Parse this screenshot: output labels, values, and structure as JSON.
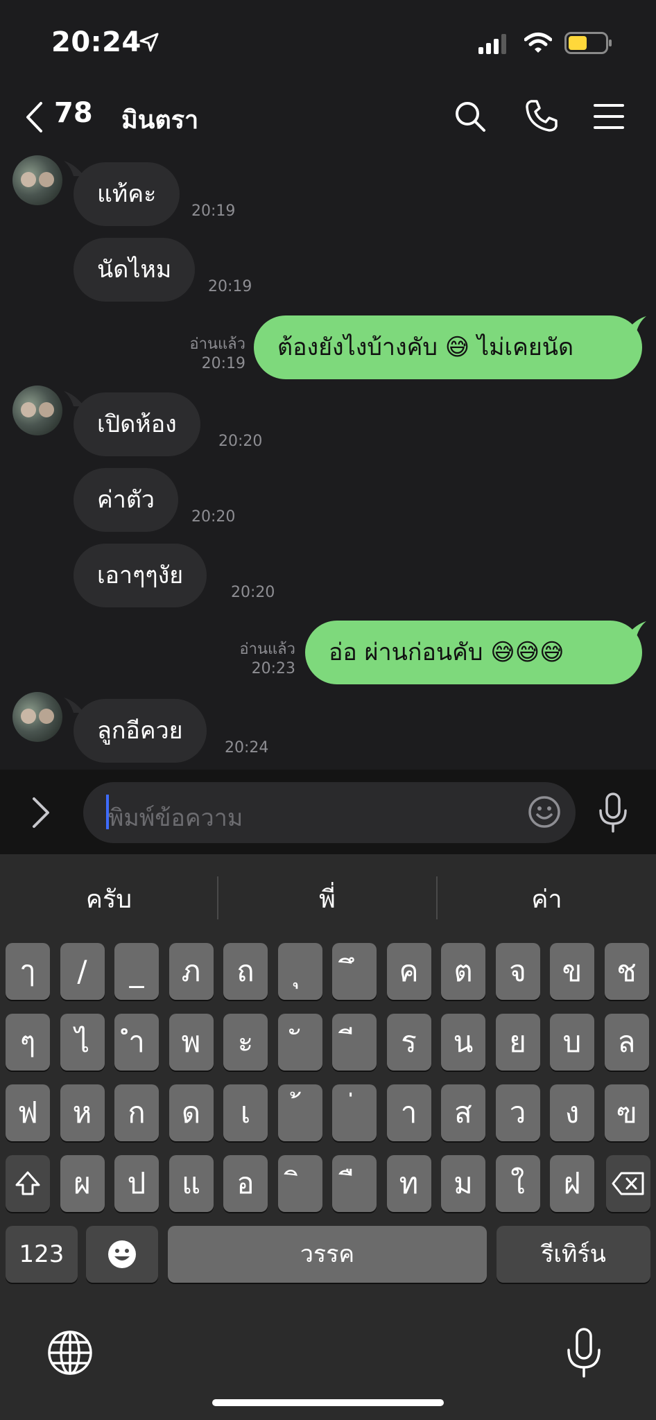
{
  "status": {
    "time": "20:24"
  },
  "header": {
    "back_count": "78",
    "contact_name": "มินตรา"
  },
  "messages": [
    {
      "side": "in",
      "text": "แท้คะ",
      "time": "20:19"
    },
    {
      "side": "in",
      "text": "นัดไหม",
      "time": "20:19"
    },
    {
      "side": "out",
      "text": "ต้องยังไงบ้างคับ 😅 ไม่เคยนัด",
      "time": "20:19",
      "read": "อ่านแล้ว"
    },
    {
      "side": "in",
      "text": "เปิดห้อง",
      "time": "20:20"
    },
    {
      "side": "in",
      "text": "ค่าตัว",
      "time": "20:20"
    },
    {
      "side": "in",
      "text": "เอาๆๆงัย",
      "time": "20:20"
    },
    {
      "side": "out",
      "text": "อ่อ ผ่านก่อนคับ 😅😅😅",
      "time": "20:23",
      "read": "อ่านแล้ว"
    },
    {
      "side": "in",
      "text": "ลูกอีควย",
      "time": "20:24"
    }
  ],
  "input": {
    "placeholder": "พิมพ์ข้อความ"
  },
  "keyboard": {
    "suggestions": [
      "ครับ",
      "พี่",
      "ค่า"
    ],
    "row1": [
      "ๅ",
      "/",
      "_",
      "ภ",
      "ถ",
      "ุ",
      "ึ",
      "ค",
      "ต",
      "จ",
      "ข",
      "ช"
    ],
    "row2": [
      "ๆ",
      "ไ",
      "ำ",
      "พ",
      "ะ",
      "ั",
      "ี",
      "ร",
      "น",
      "ย",
      "บ",
      "ล"
    ],
    "row3": [
      "ฟ",
      "ห",
      "ก",
      "ด",
      "เ",
      "้",
      "่",
      "า",
      "ส",
      "ว",
      "ง",
      "ฃ"
    ],
    "row4": [
      "ผ",
      "ป",
      "แ",
      "อ",
      "ิ",
      "ื",
      "ท",
      "ม",
      "ใ",
      "ฝ"
    ],
    "numbers_label": "123",
    "space_label": "วรรค",
    "return_label": "รีเทิร์น"
  }
}
